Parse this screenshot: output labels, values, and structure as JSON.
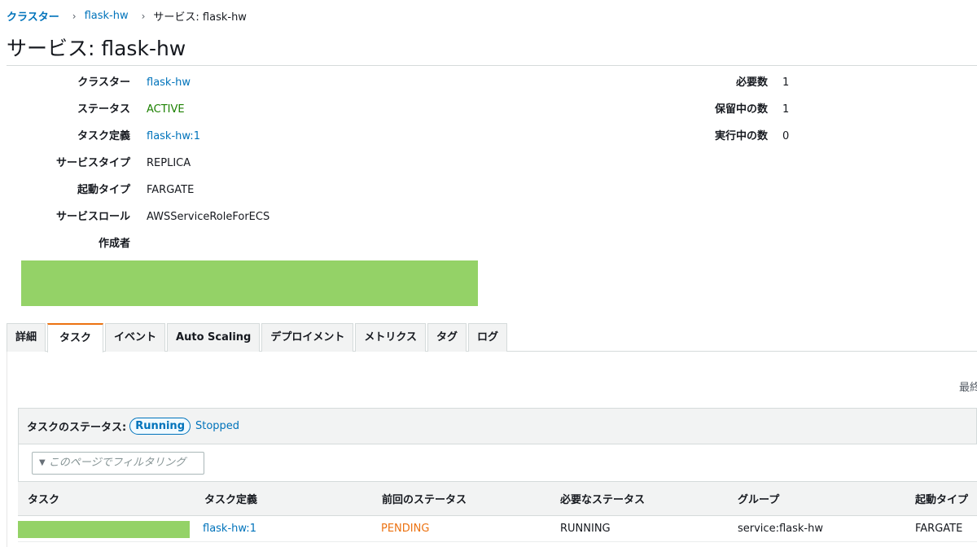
{
  "breadcrumb": {
    "items": [
      "クラスター",
      "flask-hw",
      "サービス: flask-hw"
    ],
    "separator": "›"
  },
  "page_title": "サービス: flask-hw",
  "details": {
    "left": [
      {
        "label": "クラスター",
        "value": "flask-hw",
        "kind": "link"
      },
      {
        "label": "ステータス",
        "value": "ACTIVE",
        "kind": "active"
      },
      {
        "label": "タスク定義",
        "value": "flask-hw:1",
        "kind": "link"
      },
      {
        "label": "サービスタイプ",
        "value": "REPLICA",
        "kind": "text"
      },
      {
        "label": "起動タイプ",
        "value": "FARGATE",
        "kind": "text"
      },
      {
        "label": "サービスロール",
        "value": "AWSServiceRoleForECS",
        "kind": "text"
      },
      {
        "label": "作成者",
        "value": "",
        "kind": "text"
      }
    ],
    "right": [
      {
        "label": "必要数",
        "value": "1"
      },
      {
        "label": "保留中の数",
        "value": "1"
      },
      {
        "label": "実行中の数",
        "value": "0"
      }
    ]
  },
  "tabs": [
    "詳細",
    "タスク",
    "イベント",
    "Auto Scaling",
    "デプロイメント",
    "メトリクス",
    "タグ",
    "ログ"
  ],
  "active_tab": "タスク",
  "last_updated_partial": "最終",
  "task_status": {
    "label": "タスクのステータス:",
    "options": [
      "Running",
      "Stopped"
    ],
    "selected": "Running"
  },
  "filter": {
    "placeholder": "このページでフィルタリング"
  },
  "table": {
    "columns": [
      "タスク",
      "タスク定義",
      "前回のステータス",
      "必要なステータス",
      "グループ",
      "起動タイプ"
    ],
    "rows": [
      {
        "task": "",
        "task_definition": "flask-hw:1",
        "last_status": "PENDING",
        "desired_status": "RUNNING",
        "group": "service:flask-hw",
        "launch_type": "FARGATE"
      }
    ]
  },
  "colors": {
    "link": "#0073bb",
    "active_status": "#1d8102",
    "pending_status": "#ec7211",
    "redaction": "#94d267",
    "tab_accent": "#ec7211"
  }
}
